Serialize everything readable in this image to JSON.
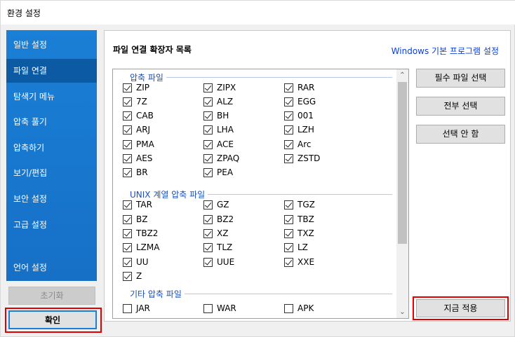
{
  "window": {
    "title": "환경 설정"
  },
  "sidebar": {
    "items": [
      {
        "label": "일반 설정",
        "name": "general"
      },
      {
        "label": "파일 연결",
        "name": "file-assoc",
        "active": true
      },
      {
        "label": "탐색기 메뉴",
        "name": "explorer-menu"
      },
      {
        "label": "압축 풀기",
        "name": "extract"
      },
      {
        "label": "압축하기",
        "name": "compress"
      },
      {
        "label": "보기/편집",
        "name": "view-edit"
      },
      {
        "label": "보안 설정",
        "name": "security"
      },
      {
        "label": "고급 설정",
        "name": "advanced"
      },
      {
        "label": "언어 설정",
        "name": "language"
      }
    ],
    "reset_label": "초기화",
    "ok_label": "확인"
  },
  "panel": {
    "title": "파일 연결 확장자 목록",
    "windows_link": "Windows 기본 프로그램 설정",
    "groups": [
      {
        "title": "압축 파일",
        "items": [
          {
            "label": "ZIP",
            "checked": true
          },
          {
            "label": "ZIPX",
            "checked": true
          },
          {
            "label": "RAR",
            "checked": true
          },
          {
            "label": "7Z",
            "checked": true
          },
          {
            "label": "ALZ",
            "checked": true
          },
          {
            "label": "EGG",
            "checked": true
          },
          {
            "label": "CAB",
            "checked": true
          },
          {
            "label": "BH",
            "checked": true
          },
          {
            "label": "001",
            "checked": true
          },
          {
            "label": "ARJ",
            "checked": true
          },
          {
            "label": "LHA",
            "checked": true
          },
          {
            "label": "LZH",
            "checked": true
          },
          {
            "label": "PMA",
            "checked": true
          },
          {
            "label": "ACE",
            "checked": true
          },
          {
            "label": "Arc",
            "checked": true
          },
          {
            "label": "AES",
            "checked": true
          },
          {
            "label": "ZPAQ",
            "checked": true
          },
          {
            "label": "ZSTD",
            "checked": true
          },
          {
            "label": "BR",
            "checked": true
          },
          {
            "label": "PEA",
            "checked": true
          }
        ]
      },
      {
        "title": "UNIX 계열 압축 파일",
        "items": [
          {
            "label": "TAR",
            "checked": true
          },
          {
            "label": "GZ",
            "checked": true
          },
          {
            "label": "TGZ",
            "checked": true
          },
          {
            "label": "BZ",
            "checked": true
          },
          {
            "label": "BZ2",
            "checked": true
          },
          {
            "label": "TBZ",
            "checked": true
          },
          {
            "label": "TBZ2",
            "checked": true
          },
          {
            "label": "XZ",
            "checked": true
          },
          {
            "label": "TXZ",
            "checked": true
          },
          {
            "label": "LZMA",
            "checked": true
          },
          {
            "label": "TLZ",
            "checked": true
          },
          {
            "label": "LZ",
            "checked": true
          },
          {
            "label": "UU",
            "checked": true
          },
          {
            "label": "UUE",
            "checked": true
          },
          {
            "label": "XXE",
            "checked": true
          },
          {
            "label": "Z",
            "checked": true
          }
        ]
      },
      {
        "title": "기타 압축 파일",
        "items": [
          {
            "label": "JAR",
            "checked": false
          },
          {
            "label": "WAR",
            "checked": false
          },
          {
            "label": "APK",
            "checked": false
          }
        ]
      }
    ],
    "buttons": {
      "select_required": "필수 파일 선택",
      "select_all": "전부 선택",
      "select_none": "선택 안 함",
      "apply_now": "지금 적용"
    }
  },
  "colors": {
    "sidebar": "#1a7fd6",
    "sidebar_active": "#0b5aa3",
    "link": "#0b3fd6",
    "group_title": "#1a4fb8",
    "highlight": "#e00000"
  }
}
